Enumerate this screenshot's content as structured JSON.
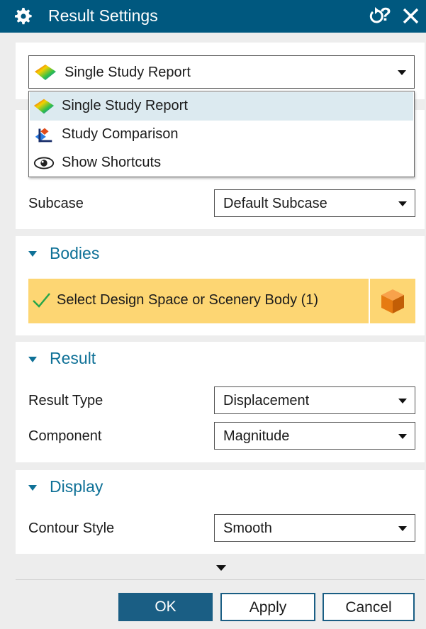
{
  "window": {
    "title": "Result Settings",
    "icons": [
      "gear-icon",
      "reset-icon",
      "help-icon",
      "close-icon"
    ],
    "help_glyph": "?"
  },
  "report_type": {
    "selected": "Single Study Report",
    "options": [
      {
        "label": "Single Study Report",
        "icon": "single-study-report-icon",
        "highlighted": true
      },
      {
        "label": "Study Comparison",
        "icon": "study-comparison-icon",
        "highlighted": false
      },
      {
        "label": "Show Shortcuts",
        "icon": "eye-icon",
        "highlighted": false
      }
    ]
  },
  "subcase": {
    "label": "Subcase",
    "value": "Default Subcase"
  },
  "bodies": {
    "title": "Bodies",
    "select_label": "Select Design Space or Scenery Body (1)"
  },
  "result": {
    "title": "Result",
    "result_type": {
      "label": "Result Type",
      "value": "Displacement"
    },
    "component": {
      "label": "Component",
      "value": "Magnitude"
    }
  },
  "display": {
    "title": "Display",
    "contour_style": {
      "label": "Contour Style",
      "value": "Smooth"
    }
  },
  "buttons": {
    "ok": "OK",
    "apply": "Apply",
    "cancel": "Cancel"
  },
  "colors": {
    "title_bar": "#00587f",
    "group_title": "#0f7197",
    "selection_highlight": "#fdd673",
    "dropdown_highlight": "#dceaf0",
    "ok_button": "#1a5e84"
  }
}
